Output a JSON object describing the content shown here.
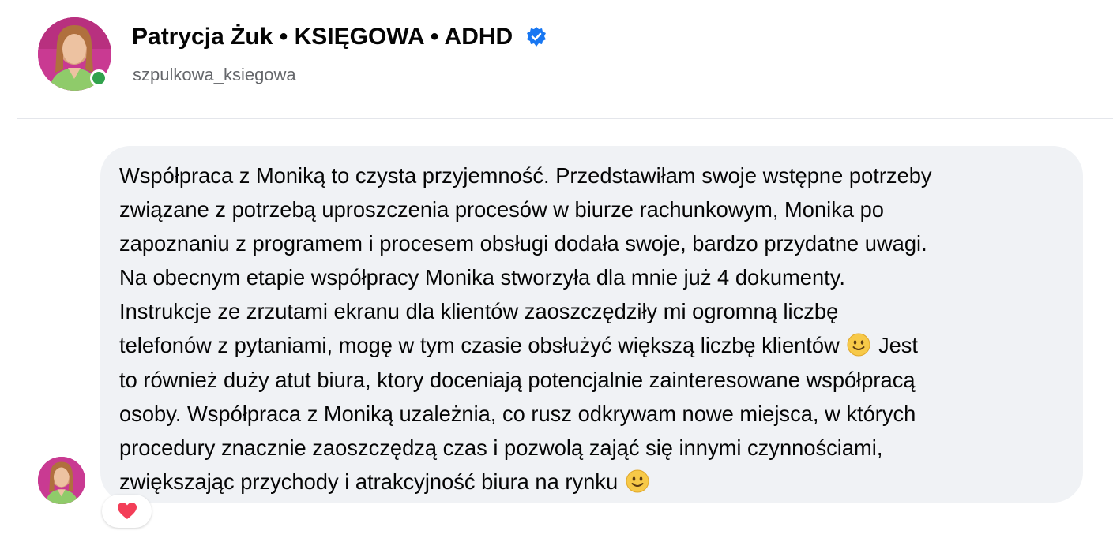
{
  "profile": {
    "name": "Patrycja Żuk • KSIĘGOWA • ADHD",
    "username": "szpulkowa_ksiegowa",
    "verified": true,
    "online": true,
    "accent_color": "#1877f2",
    "online_color": "#31a24c"
  },
  "message": {
    "text": "Współpraca z Moniką to czysta przyjemność. Przedstawiłam swoje wstępne potrzeby\nzwiązane z potrzebą uproszczenia procesów w biurze rachunkowym, Monika po\nzapoznaniu z programem i procesem obsługi dodała swoje, bardzo przydatne uwagi.\nNa obecnym etapie współpracy Monika stworzyła dla mnie już 4 dokumenty.\nInstrukcje ze zrzutami ekranu dla klientów zaoszczędziły mi ogromną liczbę\ntelefonów z pytaniami, mogę w tym czasie obsłużyć większą liczbę klientów ",
    "text_after_emoji_1": " Jest\nto również duży atut biura, ktory doceniają potencjalnie zainteresowane współpracą\nosoby. Współpraca z Moniką uzależnia, co rusz odkrywam nowe miejsca, w których\nprocedury znacznie zaoszczędzą czas i pozwolą zająć się innymi czynnościami,\nzwiększając przychody i atrakcyjność biura na rynku ",
    "emojis": [
      "slightly-smiling-face-icon",
      "slightly-smiling-face-icon"
    ],
    "bubble_color": "#f0f2f5"
  },
  "reaction": {
    "icon": "heart-icon",
    "color": "#f33e58"
  }
}
